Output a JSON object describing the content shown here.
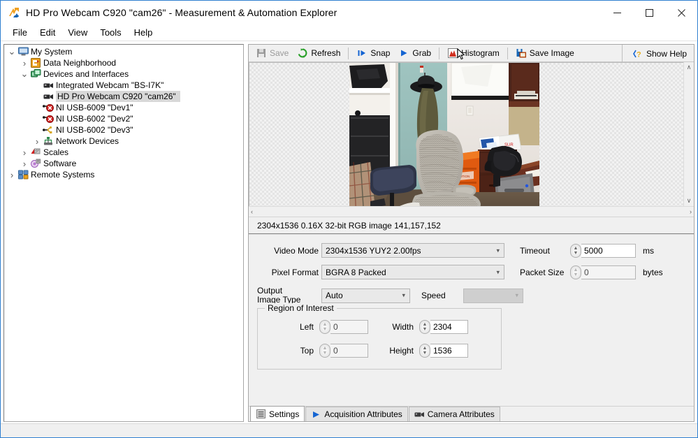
{
  "window": {
    "title": "HD Pro Webcam C920  \"cam26\" - Measurement & Automation Explorer",
    "app_icon": "ni-max-icon",
    "minimize_label": "─",
    "maximize_label": "☐",
    "close_label": "✕"
  },
  "menubar": {
    "items": [
      {
        "label": "File"
      },
      {
        "label": "Edit"
      },
      {
        "label": "View"
      },
      {
        "label": "Tools"
      },
      {
        "label": "Help"
      }
    ]
  },
  "tree": {
    "nodes": [
      {
        "label": "My System",
        "indent": 0,
        "twisty": "expanded",
        "icon": "computer-icon",
        "selected": false
      },
      {
        "label": "Data Neighborhood",
        "indent": 1,
        "twisty": "collapsed",
        "icon": "data-neighborhood-icon",
        "selected": false
      },
      {
        "label": "Devices and Interfaces",
        "indent": 1,
        "twisty": "expanded",
        "icon": "devices-icon",
        "selected": false
      },
      {
        "label": "Integrated Webcam  \"BS-I7K\"",
        "indent": 2,
        "twisty": "none",
        "icon": "camera-icon",
        "selected": false
      },
      {
        "label": "HD Pro Webcam C920  \"cam26\"",
        "indent": 2,
        "twisty": "none",
        "icon": "camera-icon",
        "selected": true
      },
      {
        "label": "NI USB-6009 \"Dev1\"",
        "indent": 2,
        "twisty": "none",
        "icon": "usb-error-icon",
        "selected": false
      },
      {
        "label": "NI USB-6002 \"Dev2\"",
        "indent": 2,
        "twisty": "none",
        "icon": "usb-error-icon",
        "selected": false
      },
      {
        "label": "NI USB-6002 \"Dev3\"",
        "indent": 2,
        "twisty": "none",
        "icon": "usb-icon",
        "selected": false
      },
      {
        "label": "Network Devices",
        "indent": 2,
        "twisty": "collapsed",
        "icon": "network-icon",
        "selected": false
      },
      {
        "label": "Scales",
        "indent": 1,
        "twisty": "collapsed",
        "icon": "scales-icon",
        "selected": false
      },
      {
        "label": "Software",
        "indent": 1,
        "twisty": "collapsed",
        "icon": "software-icon",
        "selected": false
      },
      {
        "label": "Remote Systems",
        "indent": 0,
        "twisty": "collapsed",
        "icon": "remote-systems-icon",
        "selected": false
      }
    ]
  },
  "toolbar": {
    "buttons": [
      {
        "label": "Save",
        "icon": "save-icon",
        "disabled": true
      },
      {
        "label": "Refresh",
        "icon": "refresh-icon",
        "disabled": false
      },
      {
        "label": "Snap",
        "icon": "snap-icon",
        "disabled": false
      },
      {
        "label": "Grab",
        "icon": "grab-icon",
        "disabled": false
      },
      {
        "label": "Histogram",
        "icon": "histogram-icon",
        "disabled": false
      },
      {
        "label": "Save Image",
        "icon": "save-image-icon",
        "disabled": false
      }
    ],
    "help": {
      "label": "Show Help",
      "icon": "help-icon"
    }
  },
  "viewer": {
    "status": "2304x1536  0.16X  32-bit RGB image  141,157,152",
    "scroll_up": "∧",
    "scroll_down": "∨",
    "scroll_left": "‹",
    "scroll_right": "›"
  },
  "settings": {
    "video_mode": {
      "label": "Video Mode",
      "value": "2304x1536 YUY2 2.00fps"
    },
    "pixel_format": {
      "label": "Pixel Format",
      "value": "BGRA 8 Packed"
    },
    "output_image_type": {
      "label_line1": "Output",
      "label_line2": "Image Type",
      "value": "Auto"
    },
    "speed": {
      "label": "Speed",
      "value": "",
      "disabled": true
    },
    "timeout": {
      "label": "Timeout",
      "value": "5000",
      "unit": "ms"
    },
    "packet_size": {
      "label": "Packet Size",
      "value": "0",
      "unit": "bytes",
      "disabled": true
    },
    "roi": {
      "title": "Region of Interest",
      "left": {
        "label": "Left",
        "value": "0",
        "disabled": true
      },
      "top": {
        "label": "Top",
        "value": "0",
        "disabled": true
      },
      "width": {
        "label": "Width",
        "value": "2304",
        "disabled": false
      },
      "height": {
        "label": "Height",
        "value": "1536",
        "disabled": false
      }
    }
  },
  "tabs": [
    {
      "label": "Settings",
      "icon": "settings-tab-icon",
      "active": true
    },
    {
      "label": "Acquisition Attributes",
      "icon": "acquisition-tab-icon",
      "active": false
    },
    {
      "label": "Camera Attributes",
      "icon": "camera-tab-icon",
      "active": false
    }
  ],
  "colors": {
    "window_border": "#2f7fd0",
    "panel_bg": "#f0f0f0",
    "selection": "#d8d8d8",
    "accent_orange": "#f0a020",
    "accent_blue": "#1464b4"
  }
}
